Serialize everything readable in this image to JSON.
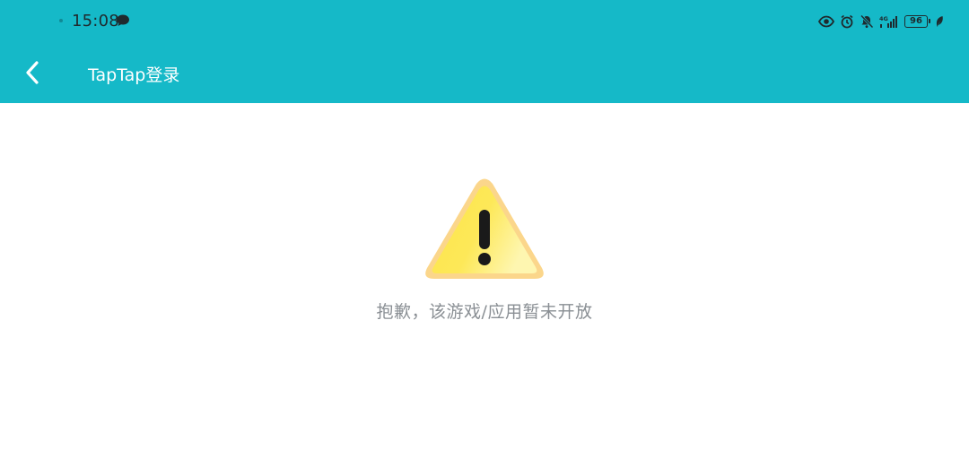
{
  "status_bar": {
    "time": "15:08",
    "network_label": "4G",
    "battery_level": "96",
    "icons": [
      "chat-bubble-icon",
      "eye-icon",
      "alarm-icon",
      "mute-bell-icon",
      "signal-icon",
      "battery-icon",
      "leaf-icon"
    ]
  },
  "app_bar": {
    "back_icon": "chevron-left-icon",
    "title": "TapTap登录"
  },
  "content": {
    "warning_icon": "warning-triangle-icon",
    "message": "抱歉，该游戏/应用暂未开放"
  },
  "colors": {
    "header_bg": "#15b9c8",
    "page_bg": "#ffffff",
    "message_text": "#8a8f94",
    "warning_fill": "#fde74c",
    "warning_border": "#fbd68b"
  }
}
